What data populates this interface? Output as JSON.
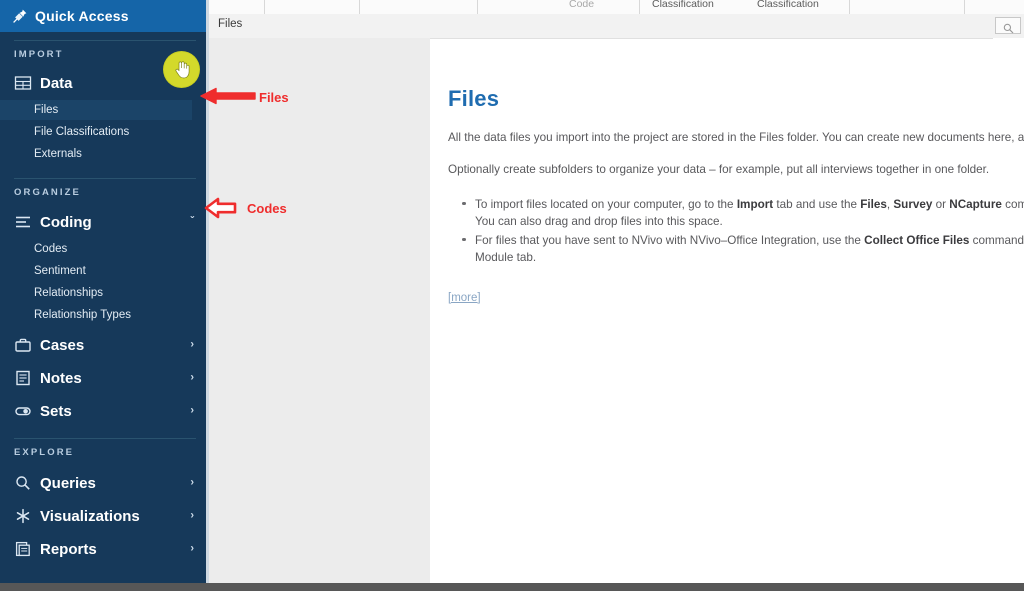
{
  "sidebar": {
    "quick_access": {
      "label": "Quick Access",
      "icon": "pin-icon"
    },
    "sections": [
      {
        "heading": "IMPORT",
        "items": [
          {
            "label": "Data",
            "icon": "grid-icon",
            "chevron": "ˇ",
            "children": [
              {
                "label": "Files",
                "selected": true
              },
              {
                "label": "File Classifications",
                "selected": false
              },
              {
                "label": "Externals",
                "selected": false
              }
            ]
          }
        ]
      },
      {
        "heading": "ORGANIZE",
        "items": [
          {
            "label": "Coding",
            "icon": "lines-icon",
            "chevron": "ˇ",
            "children": [
              {
                "label": "Codes",
                "selected": false
              },
              {
                "label": "Sentiment",
                "selected": false
              },
              {
                "label": "Relationships",
                "selected": false
              },
              {
                "label": "Relationship Types",
                "selected": false
              }
            ]
          },
          {
            "label": "Cases",
            "icon": "briefcase-icon",
            "chevron": "›",
            "children": []
          },
          {
            "label": "Notes",
            "icon": "memo-icon",
            "chevron": "›",
            "children": []
          },
          {
            "label": "Sets",
            "icon": "toggle-icon",
            "chevron": "›",
            "children": []
          }
        ]
      },
      {
        "heading": "EXPLORE",
        "items": [
          {
            "label": "Queries",
            "icon": "magnifier-icon",
            "chevron": "›",
            "children": []
          },
          {
            "label": "Visualizations",
            "icon": "asterisk-icon",
            "chevron": "›",
            "children": []
          },
          {
            "label": "Reports",
            "icon": "report-icon",
            "chevron": "›",
            "children": []
          }
        ]
      }
    ]
  },
  "ribbon": {
    "labels": [
      "Code",
      "Classification",
      "Classification"
    ]
  },
  "breadcrumb": {
    "text": "Files"
  },
  "search": {
    "icon": "search-icon",
    "placeholder": ""
  },
  "main": {
    "title": "Files",
    "paragraphs": [
      "All the data files you import into the project are stored in the Files folder. You can create new documents here, as well.",
      "Optionally create subfolders to organize your data – for example, put all interviews together in one folder."
    ],
    "bullets": [
      {
        "parts": [
          {
            "text": "To import files located on your computer, go to the ",
            "bold": false
          },
          {
            "text": "Import",
            "bold": true
          },
          {
            "text": " tab and use the ",
            "bold": false
          },
          {
            "text": "Files",
            "bold": true
          },
          {
            "text": ", ",
            "bold": false
          },
          {
            "text": "Survey",
            "bold": true
          },
          {
            "text": " or ",
            "bold": false
          },
          {
            "text": "NCapture",
            "bold": true
          },
          {
            "text": " commands. You can also drag and drop files into this space.",
            "bold": false
          }
        ]
      },
      {
        "parts": [
          {
            "text": "For files that you have sent to NVivo with NVivo–Office Integration, use the ",
            "bold": false
          },
          {
            "text": "Collect Office Files",
            "bold": true
          },
          {
            "text": " command on the Module tab.",
            "bold": false
          }
        ]
      }
    ],
    "more_link": "[more]"
  },
  "annotations": [
    {
      "label": "Files",
      "arrow": "left-arrow-filled"
    },
    {
      "label": "Codes",
      "arrow": "left-arrow-outline"
    }
  ],
  "cursor": {
    "icon": "hand-cursor-icon",
    "highlight_color": "#d3d92b"
  },
  "colors": {
    "sidebar_bg": "#16395a",
    "quick_access_bg": "#1565a8",
    "selected_row": "#1b4468",
    "title_blue": "#1f6cb0",
    "annotation_red": "#ef2d2d",
    "panel_gray": "#ececec"
  }
}
